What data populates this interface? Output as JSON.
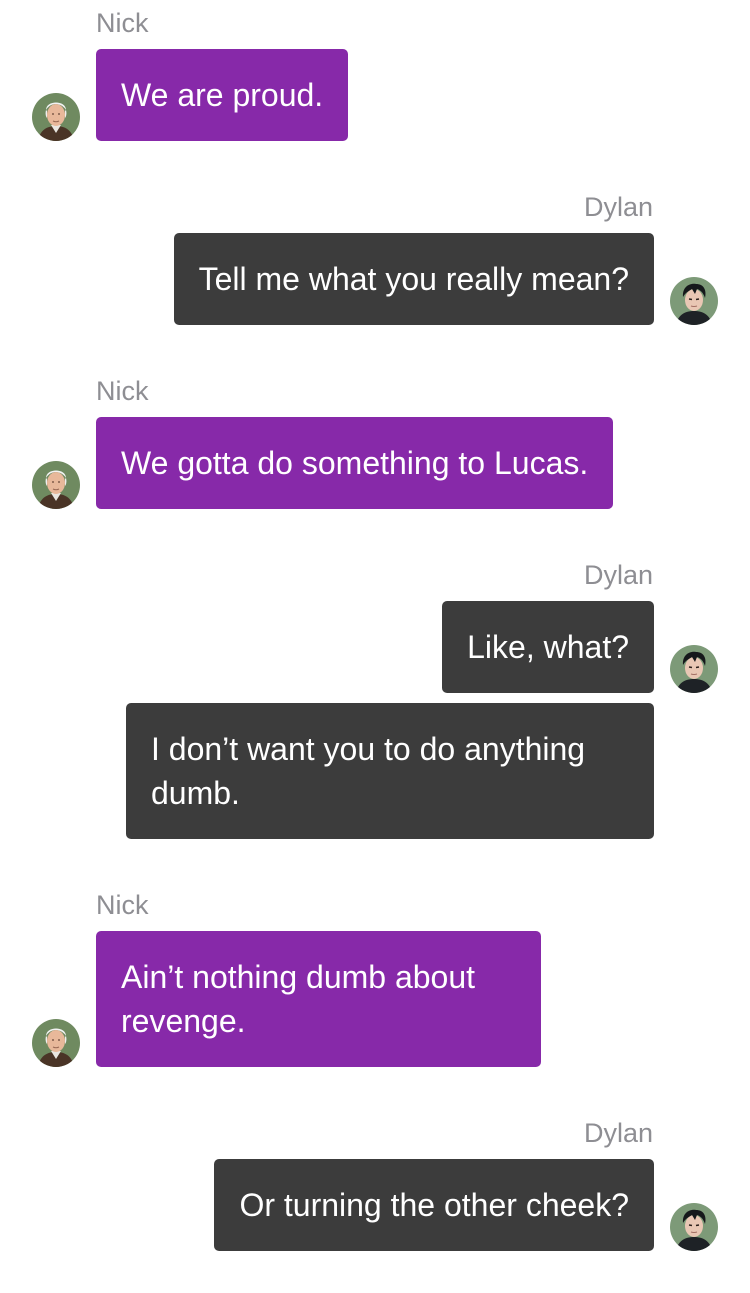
{
  "names": {
    "nick": "Nick",
    "dylan": "Dylan"
  },
  "messages": [
    {
      "sender": "Nick",
      "text": "We are proud."
    },
    {
      "sender": "Dylan",
      "text": "Tell me what you really mean?"
    },
    {
      "sender": "Nick",
      "text": "We gotta do something to Lucas."
    },
    {
      "sender": "Dylan",
      "text": "Like, what?"
    },
    {
      "sender": "Dylan",
      "text": "I don’t want you to do anything dumb."
    },
    {
      "sender": "Nick",
      "text": "Ain’t nothing dumb about revenge."
    },
    {
      "sender": "Dylan",
      "text": "Or turning the other cheek?"
    }
  ],
  "colors": {
    "nick_bubble": "#8729a9",
    "dylan_bubble": "#3c3c3c",
    "sender_label": "#8e8e93",
    "background": "#ffffff"
  },
  "icons": {
    "nick_avatar": "old-man-avatar-icon",
    "dylan_avatar": "young-man-avatar-icon"
  }
}
